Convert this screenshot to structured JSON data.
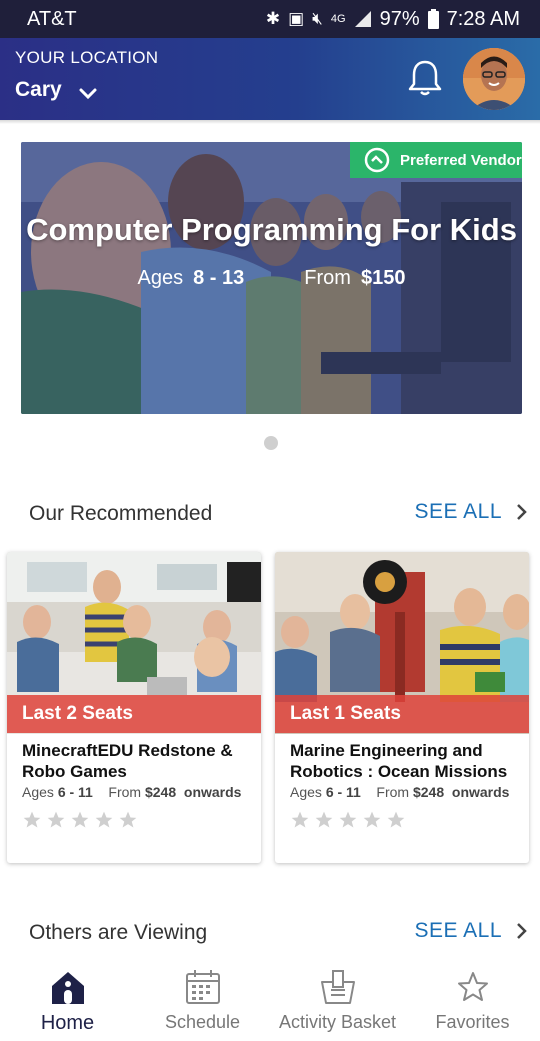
{
  "status_bar": {
    "carrier": "AT&T",
    "battery": "97%",
    "time": "7:28 AM",
    "network": "4G"
  },
  "header": {
    "location_label": "YOUR LOCATION",
    "city": "Cary"
  },
  "hero": {
    "badge": "Preferred Vendor",
    "title": "Computer Programming For Kids",
    "ages_label": "Ages",
    "ages_value": "8 - 13",
    "from_label": "From",
    "price": "$150"
  },
  "recommended": {
    "title": "Our Recommended",
    "see_all": "SEE ALL",
    "cards": [
      {
        "seats": "Last 2 Seats",
        "name": "MinecraftEDU Redstone & Robo Games",
        "ages_label": "Ages",
        "ages": "6 - 11",
        "from_label": "From",
        "price": "$248",
        "suffix": "onwards",
        "rating": 0
      },
      {
        "seats": "Last 1 Seats",
        "name": "Marine Engineering and Robotics : Ocean Missions",
        "ages_label": "Ages",
        "ages": "6 - 11",
        "from_label": "From",
        "price": "$248",
        "suffix": "onwards",
        "rating": 0
      }
    ]
  },
  "others": {
    "title": "Others are Viewing",
    "see_all": "SEE ALL"
  },
  "nav": {
    "items": [
      {
        "label": "Home",
        "icon": "home-icon",
        "active": true
      },
      {
        "label": "Schedule",
        "icon": "calendar-icon",
        "active": false
      },
      {
        "label": "Activity Basket",
        "icon": "basket-icon",
        "active": false
      },
      {
        "label": "Favorites",
        "icon": "star-icon",
        "active": false
      }
    ]
  },
  "colors": {
    "header_start": "#2b2f86",
    "header_end": "#2a6ca8",
    "badge": "#2bb56a",
    "seats": "#de423a",
    "link": "#1b6fb5",
    "nav_active": "#1e2147"
  }
}
